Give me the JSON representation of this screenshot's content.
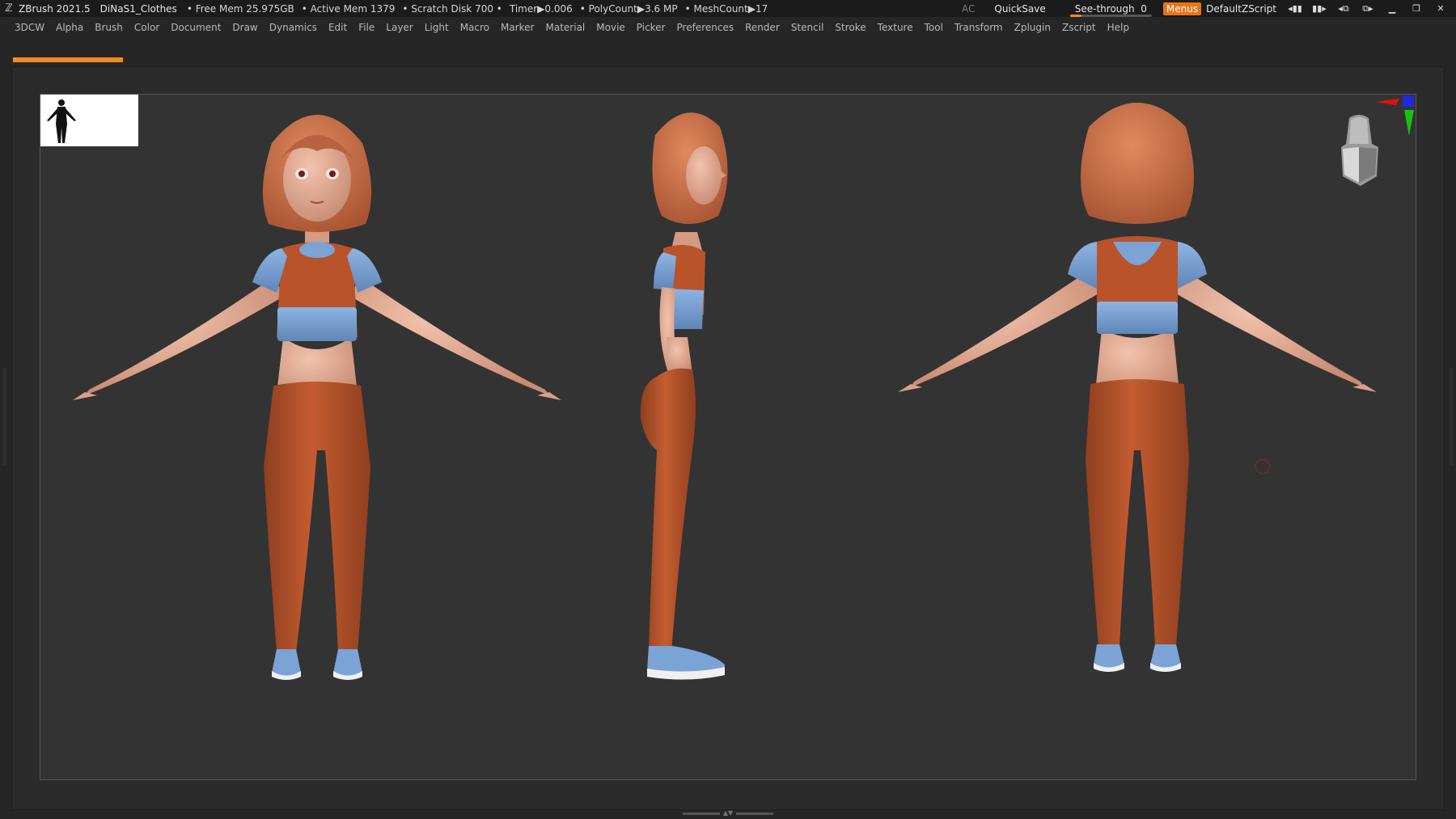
{
  "titlebar": {
    "app_name": "ZBrush 2021.5",
    "document": "DiNaS1_Clothes",
    "free_mem": "• Free Mem 25.975GB",
    "active_mem": "• Active Mem 1379",
    "scratch_disk": "• Scratch Disk 700 •",
    "timer": "Timer▶0.006",
    "polycount": "• PolyCount▶3.6 MP",
    "meshcount": "• MeshCount▶17",
    "ac": "AC",
    "quicksave": "QuickSave",
    "see_through_label": "See-through",
    "see_through_value": "0",
    "see_through_level": 0.0,
    "menus": "Menus",
    "default_zscript": "DefaultZScript"
  },
  "menubar": {
    "items": [
      "3DCW",
      "Alpha",
      "Brush",
      "Color",
      "Document",
      "Draw",
      "Dynamics",
      "Edit",
      "File",
      "Layer",
      "Light",
      "Macro",
      "Marker",
      "Material",
      "Movie",
      "Picker",
      "Preferences",
      "Render",
      "Stencil",
      "Stroke",
      "Texture",
      "Tool",
      "Transform",
      "Zplugin",
      "Zscript",
      "Help"
    ]
  },
  "colors": {
    "accent": "#f08c22",
    "skin": "#e0a48e",
    "cloth_orange": "#b8532a",
    "cloth_blue": "#7ba3d6",
    "hair": "#c9714a",
    "shoe_sole": "#f0f0f0"
  },
  "icons": [
    "zbrush-logo-icon",
    "gyro-axis-icon",
    "head-navigator-icon",
    "brush-cursor-icon",
    "window-minimize-icon",
    "window-restore-icon",
    "window-close-icon"
  ]
}
